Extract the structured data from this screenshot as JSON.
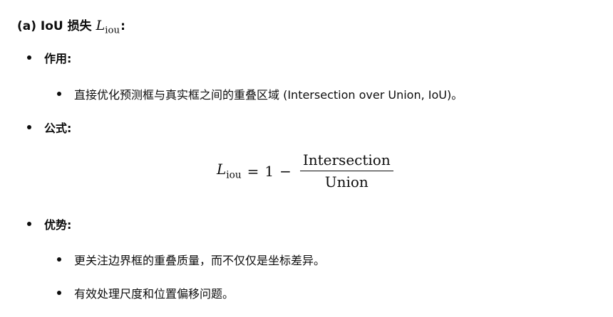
{
  "heading": {
    "prefix": "(a) IoU 损失",
    "math_var": "L",
    "math_sub": "iou",
    "suffix": ":"
  },
  "sections": [
    {
      "label": "作用:",
      "items": [
        "直接优化预测框与真实框之间的重叠区域 (Intersection over Union, IoU)。"
      ]
    },
    {
      "label": "公式:"
    },
    {
      "label": "优势:",
      "items": [
        "更关注边界框的重叠质量，而不仅仅是坐标差异。",
        "有效处理尺度和位置偏移问题。"
      ]
    }
  ],
  "formula": {
    "lhs_var": "L",
    "lhs_sub": "iou",
    "equals": "=",
    "one": "1",
    "minus": "−",
    "numerator": "Intersection",
    "denominator": "Union"
  }
}
